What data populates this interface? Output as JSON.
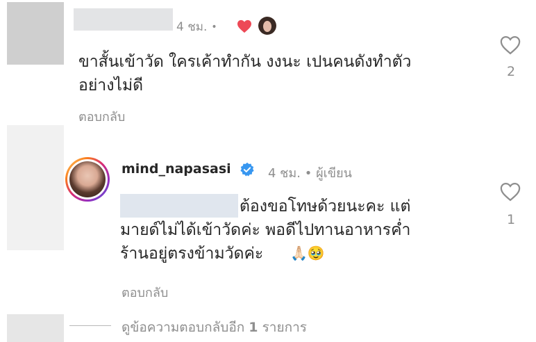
{
  "comment1": {
    "time": "4 ชม.",
    "separator": "•",
    "text_line1": "ขาสั้นเข้าวัด ใครเค้าทำกัน งงนะ เปนคนดังทำตัว",
    "text_line2": "อย่างไม่ดี",
    "reply_label": "ตอบกลับ",
    "like_count": "2",
    "liked_by_creator": true
  },
  "comment2": {
    "username": "mind_napasasi",
    "time": "4 ชม.",
    "separator": "•",
    "author_badge": "ผู้เขียน",
    "text_line1": "ต้องขอโทษด้วยนะคะ แต่",
    "text_line2": "มายด์ไม่ได้เข้าวัดค่ะ พอดีไปทานอาหารค่ำ",
    "text_line3": "ร้านอยู่ตรงข้ามวัดค่ะ",
    "emojis": "🙏🏻🥹",
    "reply_label": "ตอบกลับ",
    "like_count": "1",
    "verified": true
  },
  "view_replies": {
    "prefix": "ดูข้อความตอบกลับอีก ",
    "count": "1",
    "suffix": " รายการ"
  },
  "colors": {
    "text": "#262626",
    "secondary": "#8e8e8e",
    "heart": "#ed4956",
    "verified": "#3897f0"
  }
}
